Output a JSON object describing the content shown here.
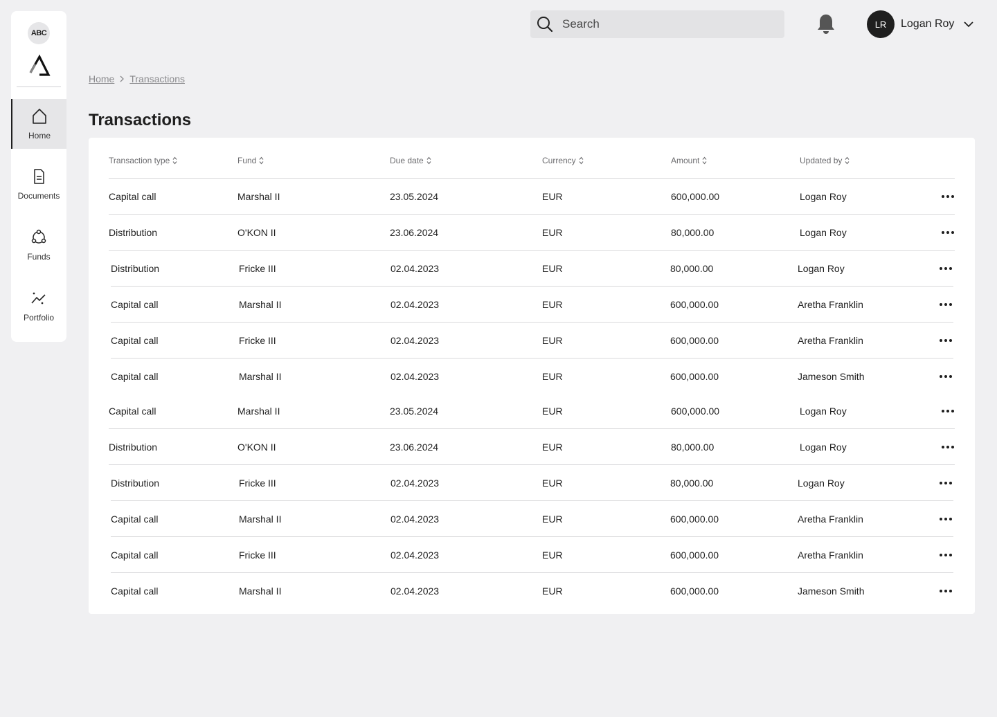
{
  "sidebar": {
    "brand_badge": "ABC",
    "nav": [
      {
        "label": "Home",
        "icon": "home-icon",
        "active": true
      },
      {
        "label": "Documents",
        "icon": "document-icon",
        "active": false
      },
      {
        "label": "Funds",
        "icon": "funds-icon",
        "active": false
      },
      {
        "label": "Portfolio",
        "icon": "portfolio-icon",
        "active": false
      }
    ]
  },
  "topbar": {
    "search_placeholder": "Search",
    "user": {
      "initials": "LR",
      "name": "Logan Roy"
    }
  },
  "breadcrumb": {
    "home": "Home",
    "current": "Transactions"
  },
  "page": {
    "title": "Transactions"
  },
  "table": {
    "columns": [
      "Transaction type",
      "Fund",
      "Due date",
      "Currency",
      "Amount",
      "Updated by"
    ],
    "rows": [
      [
        "Capital call",
        "Marshal II",
        "23.05.2024",
        "EUR",
        "600,000.00",
        "Logan Roy"
      ],
      [
        "Distribution",
        "O'KON II",
        "23.06.2024",
        "EUR",
        "80,000.00",
        "Logan Roy"
      ],
      [
        "Distribution",
        "Fricke III",
        "02.04.2023",
        "EUR",
        "80,000.00",
        "Logan Roy"
      ],
      [
        "Capital call",
        "Marshal II",
        "02.04.2023",
        "EUR",
        "600,000.00",
        "Aretha Franklin"
      ],
      [
        "Capital call",
        "Fricke III",
        "02.04.2023",
        "EUR",
        "600,000.00",
        "Aretha Franklin"
      ],
      [
        "Capital call",
        "Marshal II",
        "02.04.2023",
        "EUR",
        "600,000.00",
        "Jameson Smith"
      ],
      [
        "Capital call",
        "Marshal II",
        "23.05.2024",
        "EUR",
        "600,000.00",
        "Logan Roy"
      ],
      [
        "Distribution",
        "O'KON II",
        "23.06.2024",
        "EUR",
        "80,000.00",
        "Logan Roy"
      ],
      [
        "Distribution",
        "Fricke III",
        "02.04.2023",
        "EUR",
        "80,000.00",
        "Logan Roy"
      ],
      [
        "Capital call",
        "Marshal II",
        "02.04.2023",
        "EUR",
        "600,000.00",
        "Aretha Franklin"
      ],
      [
        "Capital call",
        "Fricke III",
        "02.04.2023",
        "EUR",
        "600,000.00",
        "Aretha Franklin"
      ],
      [
        "Capital call",
        "Marshal II",
        "02.04.2023",
        "EUR",
        "600,000.00",
        "Jameson Smith"
      ]
    ]
  }
}
